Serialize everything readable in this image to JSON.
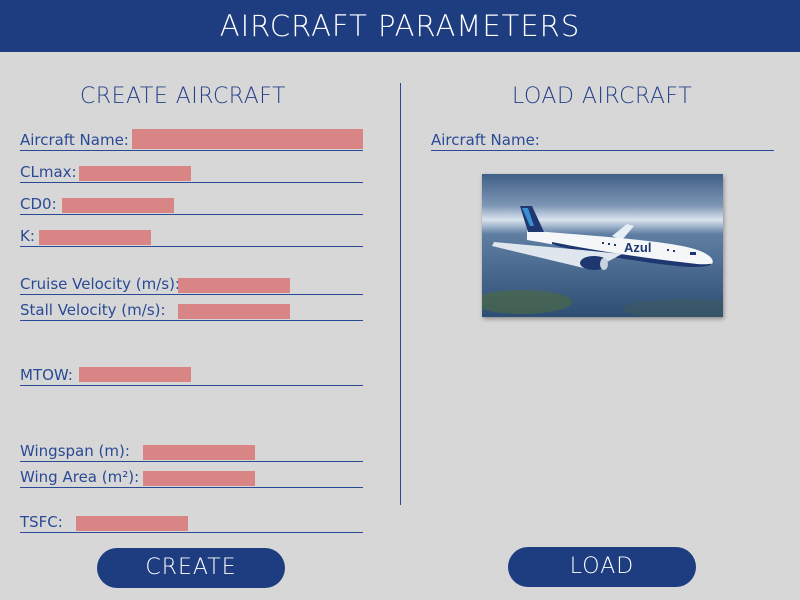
{
  "header": {
    "title": "AIRCRAFT PARAMETERS"
  },
  "create": {
    "title": "CREATE AIRCRAFT",
    "fields": {
      "name": "Aircraft Name:",
      "clmax": "CLmax:",
      "cd0": "CD0:",
      "k": "K:",
      "cruise": "Cruise Velocity (m/s):",
      "stall": "Stall Velocity (m/s):",
      "mtow": "MTOW:",
      "wingspan": "Wingspan (m):",
      "wingarea": "Wing Area (m²):",
      "tsfc": "TSFC:"
    },
    "button": "CREATE"
  },
  "load": {
    "title": "LOAD AIRCRAFT",
    "name_label": "Aircraft Name:",
    "image_text": "Azul",
    "button": "LOAD"
  },
  "colors": {
    "header_bg": "#1e3c80",
    "input_fill": "#d98585",
    "background": "#d7d7d7"
  }
}
